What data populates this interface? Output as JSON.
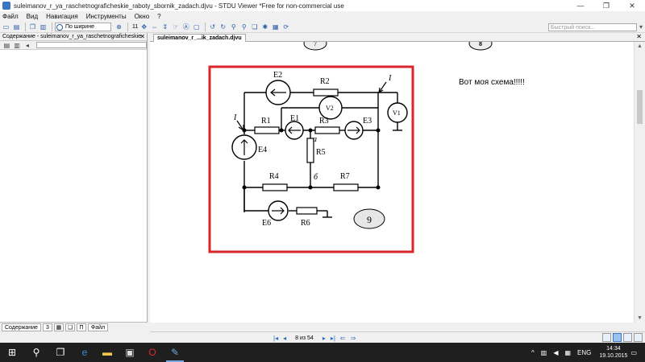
{
  "window": {
    "title": "suleimanov_r_ya_raschetnograficheskie_raboty_sbornik_zadach.djvu - STDU Viewer *Free for non-commercial use",
    "buttons": [
      "—",
      "❐",
      "✕"
    ]
  },
  "menu": [
    "Файл",
    "Вид",
    "Навигация",
    "Инструменты",
    "Окно",
    "?"
  ],
  "toolbar": {
    "zoom_label": "По ширине",
    "page_number": "11",
    "search_placeholder": "Быстрый поиск..."
  },
  "sidebar": {
    "header": "Содержание - suleimanov_r_ya_raschetnograficheskie",
    "tabs": [
      "Содержание",
      "3",
      "",
      "",
      "П",
      "Файл"
    ]
  },
  "document": {
    "tab_label": "suleimanov_r_...ik_zadach.djvu",
    "annotation": "Вот моя схема!!!!!",
    "page_numbers": [
      "7",
      "8",
      "9"
    ],
    "circuit": {
      "labels": [
        "E2",
        "R2",
        "I",
        "V1",
        "V2",
        "R1",
        "E1",
        "R3",
        "E3",
        "I",
        "E4",
        "a",
        "R5",
        "R4",
        "б",
        "R7",
        "E6",
        "R6"
      ]
    },
    "highlight_color": "#d9252a"
  },
  "status": {
    "page_indicator": "8 из 54"
  },
  "taskbar": {
    "language": "ENG",
    "time": "14:34",
    "date": "19.10.2015"
  }
}
